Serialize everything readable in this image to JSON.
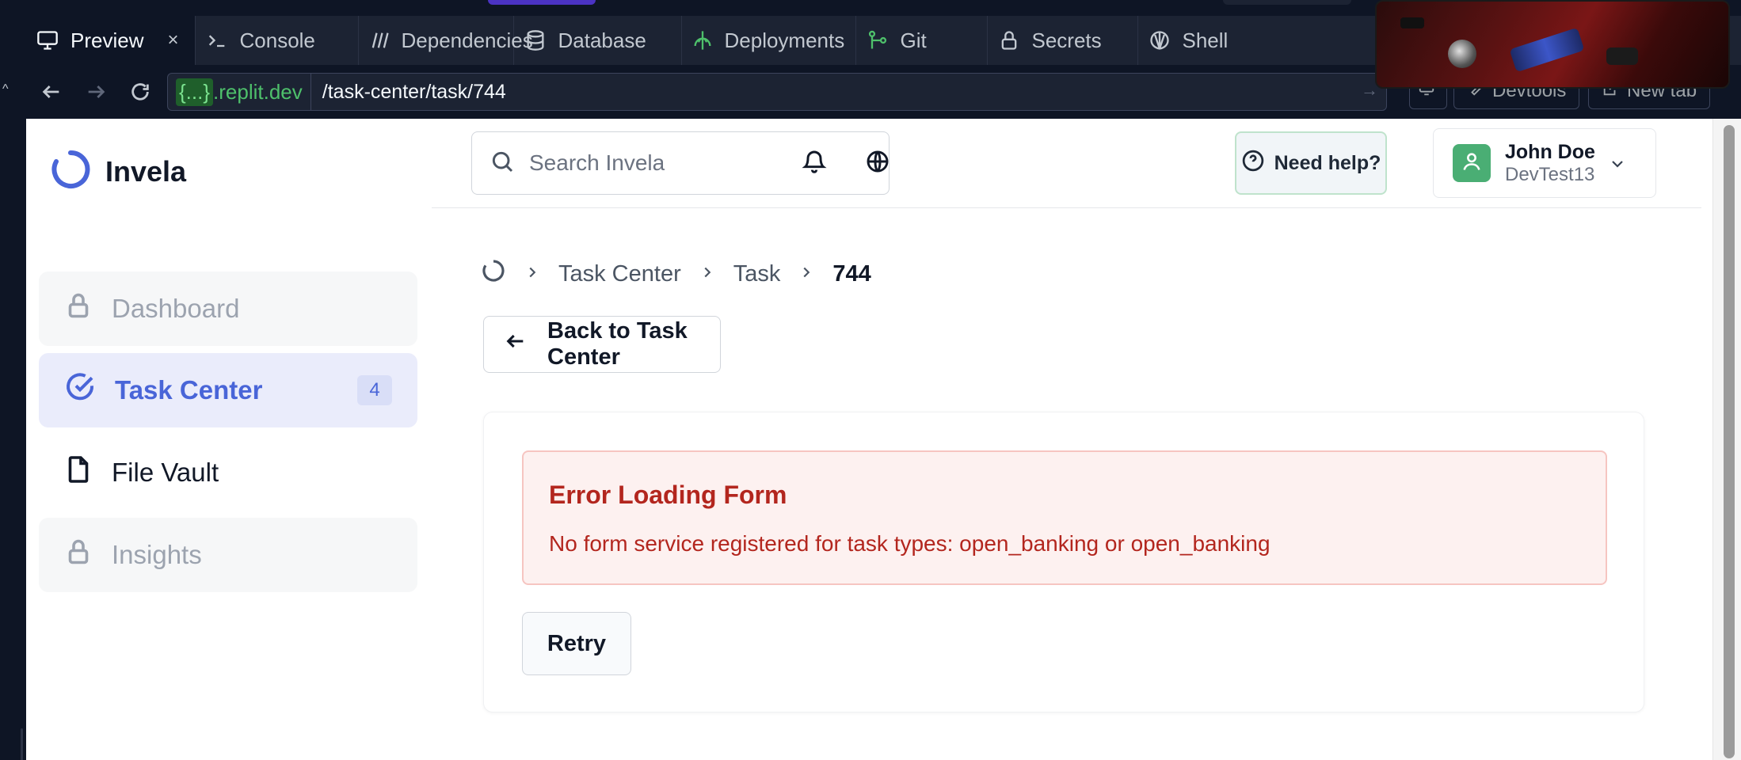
{
  "ide": {
    "tabs": [
      {
        "label": "Preview",
        "icon": "monitor-icon",
        "active": true
      },
      {
        "label": "Console",
        "icon": "terminal-icon"
      },
      {
        "label": "Dependencies",
        "icon": "dependencies-icon"
      },
      {
        "label": "Database",
        "icon": "database-icon"
      },
      {
        "label": "Deployments",
        "icon": "deployments-icon"
      },
      {
        "label": "Git",
        "icon": "git-icon"
      },
      {
        "label": "Secrets",
        "icon": "lock-icon"
      },
      {
        "label": "Shell",
        "icon": "shell-icon"
      }
    ],
    "close_glyph": "×",
    "url": {
      "braces": "{...}",
      "domain": ".replit.dev",
      "path": "/task-center/task/744"
    },
    "buttons": {
      "devtools": "Devtools",
      "new_tab": "New tab"
    }
  },
  "app": {
    "brand": "Invela",
    "search": {
      "placeholder": "Search Invela"
    },
    "help_label": "Need help?",
    "user": {
      "name": "John Doe",
      "org": "DevTest13"
    },
    "nav": [
      {
        "label": "Dashboard",
        "state": "locked"
      },
      {
        "label": "Task Center",
        "state": "active",
        "badge": "4"
      },
      {
        "label": "File Vault",
        "state": "normal"
      },
      {
        "label": "Insights",
        "state": "locked"
      }
    ],
    "breadcrumb": {
      "items": [
        "Task Center",
        "Task"
      ],
      "current": "744",
      "separator": ">"
    },
    "back_label": "Back to Task Center",
    "error": {
      "title": "Error Loading Form",
      "message": "No form service registered for task types: open_banking or open_banking"
    },
    "retry_label": "Retry"
  },
  "colors": {
    "ide_bg": "#0e1525",
    "accent_blue": "#4965d8",
    "error_red": "#b3261e",
    "error_bg": "#fdf1f0",
    "avatar_green": "#4aae74"
  }
}
